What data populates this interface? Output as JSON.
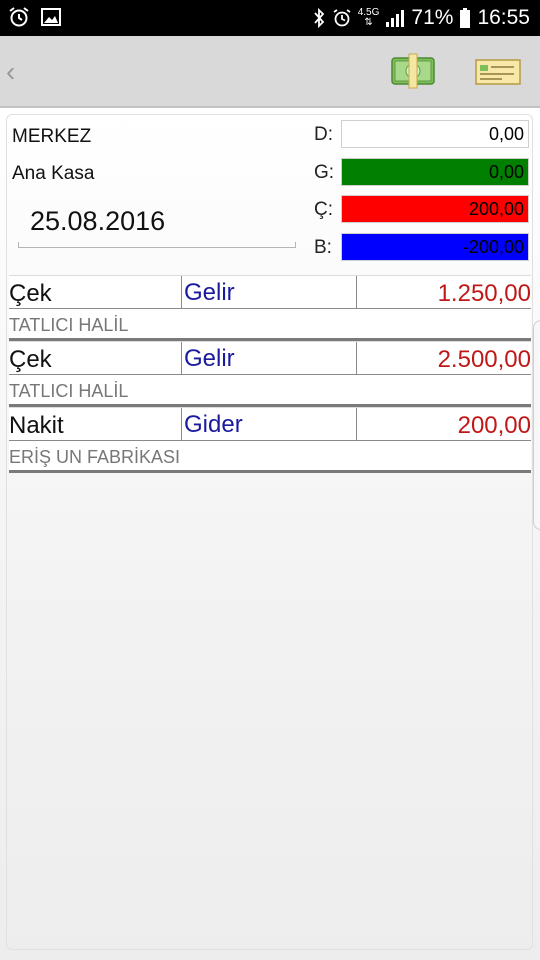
{
  "status_bar": {
    "network": "4.5G",
    "battery": "71%",
    "time": "16:55"
  },
  "header": {
    "back_icon": "chevron-left-icon",
    "actions": [
      "cash-money-icon",
      "check-cheque-icon"
    ]
  },
  "info": {
    "branch": "MERKEZ",
    "account": "Ana Kasa",
    "date": "25.08.2016"
  },
  "summary": [
    {
      "key": "D:",
      "value": "0,00",
      "color": "#ffffff"
    },
    {
      "key": "G:",
      "value": "0,00",
      "color": "#007f00"
    },
    {
      "key": "Ç:",
      "value": "200,00",
      "color": "#ff0000"
    },
    {
      "key": "B:",
      "value": "-200,00",
      "color": "#0000ff"
    }
  ],
  "transactions": [
    {
      "type": "Çek",
      "kind": "Gelir",
      "amount": "1.250,00",
      "description": "TATLICI HALİL"
    },
    {
      "type": "Çek",
      "kind": "Gelir",
      "amount": "2.500,00",
      "description": "TATLICI HALİL"
    },
    {
      "type": "Nakit",
      "kind": "Gider",
      "amount": "200,00",
      "description": "ERİŞ UN FABRİKASI"
    }
  ]
}
